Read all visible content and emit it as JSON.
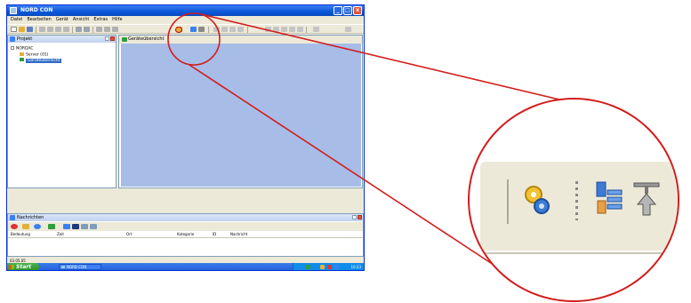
{
  "window": {
    "title": "NORD CON",
    "buttons": [
      "_",
      "□",
      "x"
    ]
  },
  "menu": [
    "Datei",
    "Bearbeiten",
    "Gerät",
    "Ansicht",
    "Extras",
    "Hilfe"
  ],
  "project_pane": {
    "title": "Projekt",
    "tree": {
      "root": "NORDAC",
      "child": "Server (01)",
      "selected": "Geräteübersicht"
    }
  },
  "center_pane": {
    "tab": "Geräteübersicht"
  },
  "messages_pane": {
    "title": "Nachrichten",
    "columns": [
      "Bedeutung",
      "Zeit",
      "Ort",
      "Kategorie",
      "ID",
      "Nachricht"
    ]
  },
  "statusbar": {
    "text": "03.05.05"
  },
  "taskbar": {
    "start_label": "Start",
    "task_label": "NORD CON",
    "clock": "10:23"
  },
  "callout": {
    "icons": [
      "gear-key-icon",
      "separator-grip",
      "device-tree-icon",
      "network-node-icon"
    ]
  },
  "colors": {
    "xp_blue": "#0a57d9",
    "highlight_circle": "#d31c1c",
    "workspace": "#a7bce7",
    "selection": "#316ac5"
  }
}
